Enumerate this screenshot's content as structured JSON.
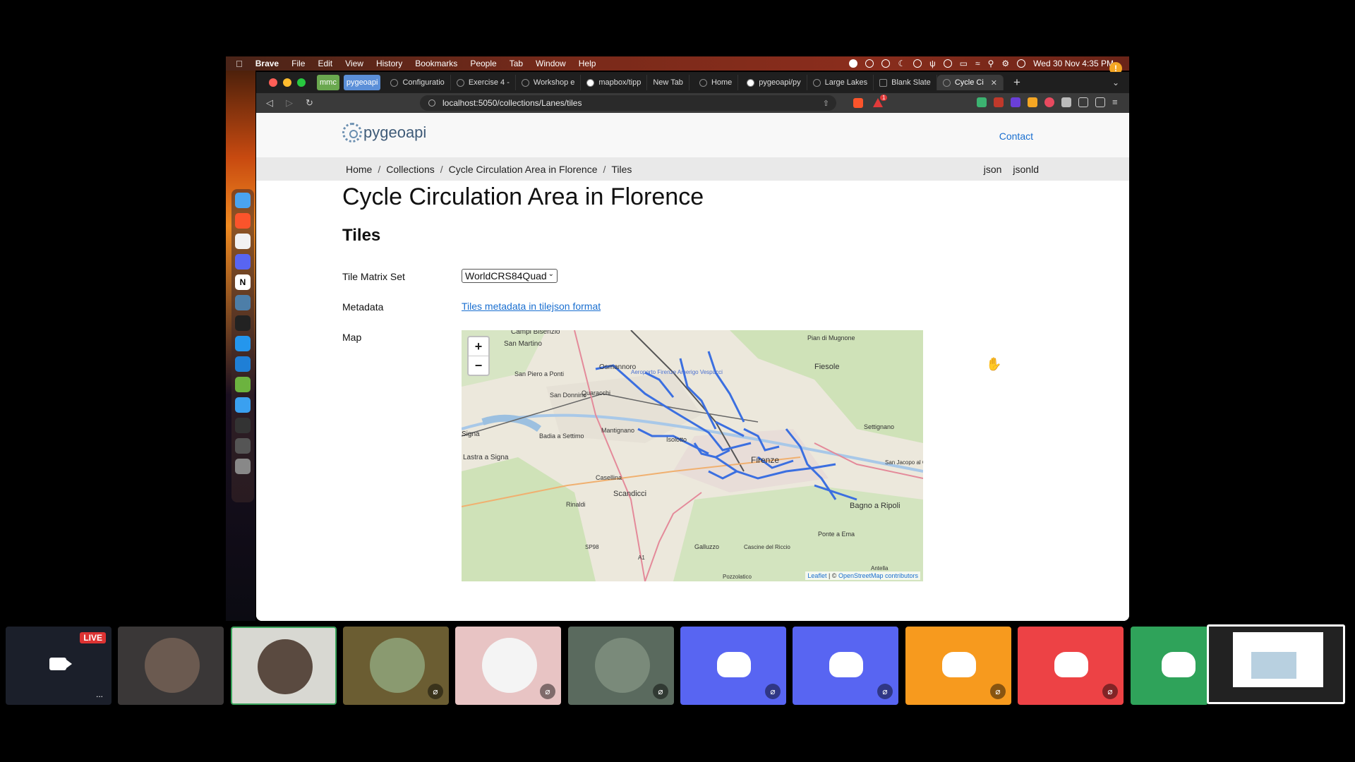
{
  "menubar": {
    "app": "Brave",
    "items": [
      "File",
      "Edit",
      "View",
      "History",
      "Bookmarks",
      "People",
      "Tab",
      "Window",
      "Help"
    ],
    "clock": "Wed 30 Nov  4:35 PM",
    "notification": "!"
  },
  "browser": {
    "pinned": [
      "mmc",
      "pygeoapi"
    ],
    "tabs": [
      "Configuratio",
      "Exercise 4 -",
      "Workshop e",
      "mapbox/tipp",
      "New Tab",
      "Home",
      "pygeoapi/py",
      "Large Lakes",
      "Blank Slate",
      "Cycle Ci"
    ],
    "new_tab": "+",
    "url": "localhost:5050/collections/Lanes/tiles",
    "brave_badge": "1"
  },
  "page": {
    "logo": "pygeoapi",
    "contact": "Contact",
    "breadcrumbs": [
      "Home",
      "Collections",
      "Cycle Circulation Area in Florence",
      "Tiles"
    ],
    "crumb_sep": "/",
    "formats": [
      "json",
      "jsonld"
    ],
    "title": "Cycle Circulation Area in Florence",
    "subtitle": "Tiles",
    "labels": {
      "tms": "Tile Matrix Set",
      "metadata": "Metadata",
      "map": "Map"
    },
    "tms_value": "WorldCRS84Quad",
    "metadata_link": "Tiles metadata in tilejson format",
    "zoom_in": "+",
    "zoom_out": "−",
    "attribution": {
      "leaflet": "Leaflet",
      "sep": " | © ",
      "osm": "OpenStreetMap contributors"
    },
    "places": [
      "Campi Bisenzio",
      "San Martino",
      "Osmannoro",
      "Aeroporto Firenze Amerigo Vespucci",
      "Fiesole",
      "Pian di Mugnone",
      "San Piero a Ponti",
      "San Donnino",
      "Quaracchi",
      "Settignano",
      "Signa",
      "Badia a Settimo",
      "Mantignano",
      "Isolotto",
      "Firenze",
      "San Jacopo al Girone",
      "Lastra a Signa",
      "Casellina",
      "Scandicci",
      "Bagno a Ripoli",
      "Rinaldi",
      "SP98",
      "A1",
      "Galluzzo",
      "Cascine del Riccio",
      "Ponte a Ema",
      "Pozzolatico",
      "Antella"
    ]
  },
  "call": {
    "live": "LIVE",
    "more": "...",
    "mute_glyph": "⌀"
  },
  "colors": {
    "cycle_lanes": "#3b6fe0",
    "link": "#1a6fd0",
    "discord_blue": "#5865f2",
    "discord_orange": "#f79a1e",
    "discord_red": "#ed4245",
    "discord_green": "#2fa35a"
  }
}
